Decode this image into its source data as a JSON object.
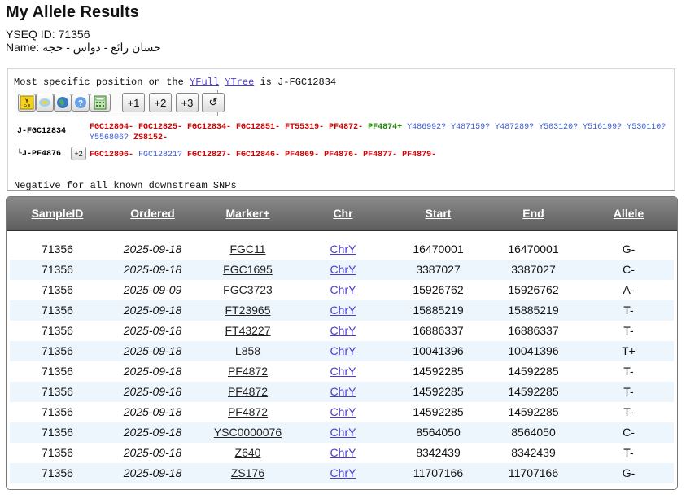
{
  "header": {
    "title": "My Allele Results",
    "yseq_id": "YSEQ ID: 71356",
    "name": "Name: حسان رائع - دواس - حجة"
  },
  "snp_panel": {
    "msp_prefix": "Most specific position on the",
    "link_yfull": "YFull",
    "link_ytree": "YTree",
    "msp_suffix": "is J-FGC12834",
    "toolbar": {
      "yfull_icon": "yfull-icon",
      "map_icon": "map-icon",
      "globe_icon": "globe-icon",
      "help_icon": "help-icon",
      "calc_icon": "calculator-icon",
      "plus1": "+1",
      "plus2": "+2",
      "plus3": "+3",
      "reset": "↺"
    },
    "rows": [
      {
        "label": "J-FGC12834",
        "snps": [
          {
            "t": "FGC12804-",
            "s": "neg"
          },
          {
            "t": "FGC12825-",
            "s": "neg"
          },
          {
            "t": "FGC12834-",
            "s": "neg"
          },
          {
            "t": "FGC12851-",
            "s": "neg"
          },
          {
            "t": "FT55319-",
            "s": "neg"
          },
          {
            "t": "PF4872-",
            "s": "neg"
          },
          {
            "t": "PF4874+",
            "s": "pos"
          },
          {
            "t": "Y486992?",
            "s": "unk"
          },
          {
            "t": "Y487159?",
            "s": "unk"
          },
          {
            "t": "Y487289?",
            "s": "unk"
          },
          {
            "t": "Y503120?",
            "s": "unk"
          },
          {
            "t": "Y516199?",
            "s": "unk"
          },
          {
            "t": "Y530110?",
            "s": "unk"
          },
          {
            "t": "Y556806?",
            "s": "unk"
          },
          {
            "t": "ZS8152-",
            "s": "neg"
          }
        ]
      },
      {
        "label": "└J-PF4876",
        "expand": "+2",
        "snps": [
          {
            "t": "FGC12806-",
            "s": "neg"
          },
          {
            "t": "FGC12821?",
            "s": "unk"
          },
          {
            "t": "FGC12827-",
            "s": "neg"
          },
          {
            "t": "FGC12846-",
            "s": "neg"
          },
          {
            "t": "PF4869-",
            "s": "neg"
          },
          {
            "t": "PF4876-",
            "s": "neg"
          },
          {
            "t": "PF4877-",
            "s": "neg"
          },
          {
            "t": "PF4879-",
            "s": "neg"
          }
        ]
      }
    ],
    "negative_note": "Negative for all known downstream SNPs"
  },
  "table": {
    "columns": [
      "SampleID",
      "Ordered",
      "Marker+",
      "Chr",
      "Start",
      "End",
      "Allele"
    ],
    "rows": [
      [
        "71356",
        "2025-09-18",
        "FGC11",
        "ChrY",
        "16470001",
        "16470001",
        "G-"
      ],
      [
        "71356",
        "2025-09-18",
        "FGC1695",
        "ChrY",
        "3387027",
        "3387027",
        "C-"
      ],
      [
        "71356",
        "2025-09-09",
        "FGC3723",
        "ChrY",
        "15926762",
        "15926762",
        "A-"
      ],
      [
        "71356",
        "2025-09-18",
        "FT23965",
        "ChrY",
        "15885219",
        "15885219",
        "T-"
      ],
      [
        "71356",
        "2025-09-18",
        "FT43227",
        "ChrY",
        "16886337",
        "16886337",
        "T-"
      ],
      [
        "71356",
        "2025-09-18",
        "L858",
        "ChrY",
        "10041396",
        "10041396",
        "T+"
      ],
      [
        "71356",
        "2025-09-18",
        "PF4872",
        "ChrY",
        "14592285",
        "14592285",
        "T-"
      ],
      [
        "71356",
        "2025-09-18",
        "PF4872",
        "ChrY",
        "14592285",
        "14592285",
        "T-"
      ],
      [
        "71356",
        "2025-09-18",
        "PF4872",
        "ChrY",
        "14592285",
        "14592285",
        "T-"
      ],
      [
        "71356",
        "2025-09-18",
        "YSC0000076",
        "ChrY",
        "8564050",
        "8564050",
        "C-"
      ],
      [
        "71356",
        "2025-09-18",
        "Z640",
        "ChrY",
        "8342439",
        "8342439",
        "T-"
      ],
      [
        "71356",
        "2025-09-18",
        "ZS176",
        "ChrY",
        "11707166",
        "11707166",
        "G-"
      ]
    ]
  }
}
